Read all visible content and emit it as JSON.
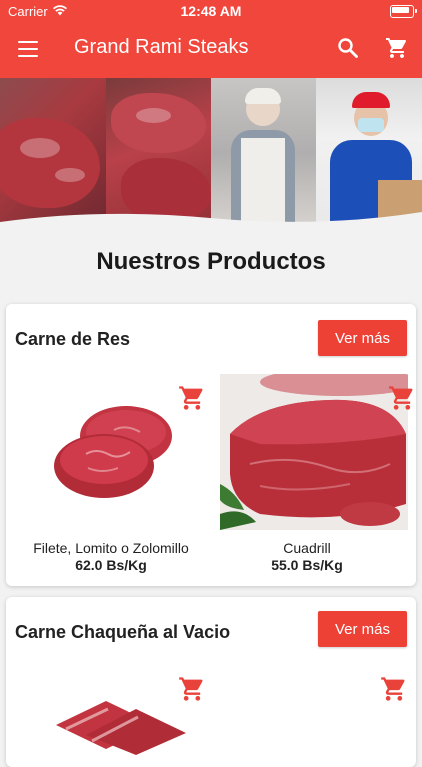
{
  "status_bar": {
    "carrier": "Carrier",
    "time": "12:48 AM"
  },
  "app_bar": {
    "title": "Grand Rami Steaks",
    "menu_icon": "menu-icon",
    "search_icon": "search-icon",
    "cart_icon": "shopping-cart-icon"
  },
  "colors": {
    "primary": "#f0463c",
    "button": "#ee4136"
  },
  "section_title": "Nuestros Productos",
  "categories": [
    {
      "title": "Carne de Res",
      "more_label": "Ver más",
      "products": [
        {
          "name": "Filete, Lomito o Zolomillo",
          "price": "62.0 Bs/Kg"
        },
        {
          "name": "Cuadrill",
          "price": "55.0 Bs/Kg"
        }
      ]
    },
    {
      "title": "Carne Chaqueña al Vacio",
      "more_label": "Ver más",
      "products": [
        {
          "name": "",
          "price": ""
        },
        {
          "name": "",
          "price": ""
        }
      ]
    }
  ]
}
